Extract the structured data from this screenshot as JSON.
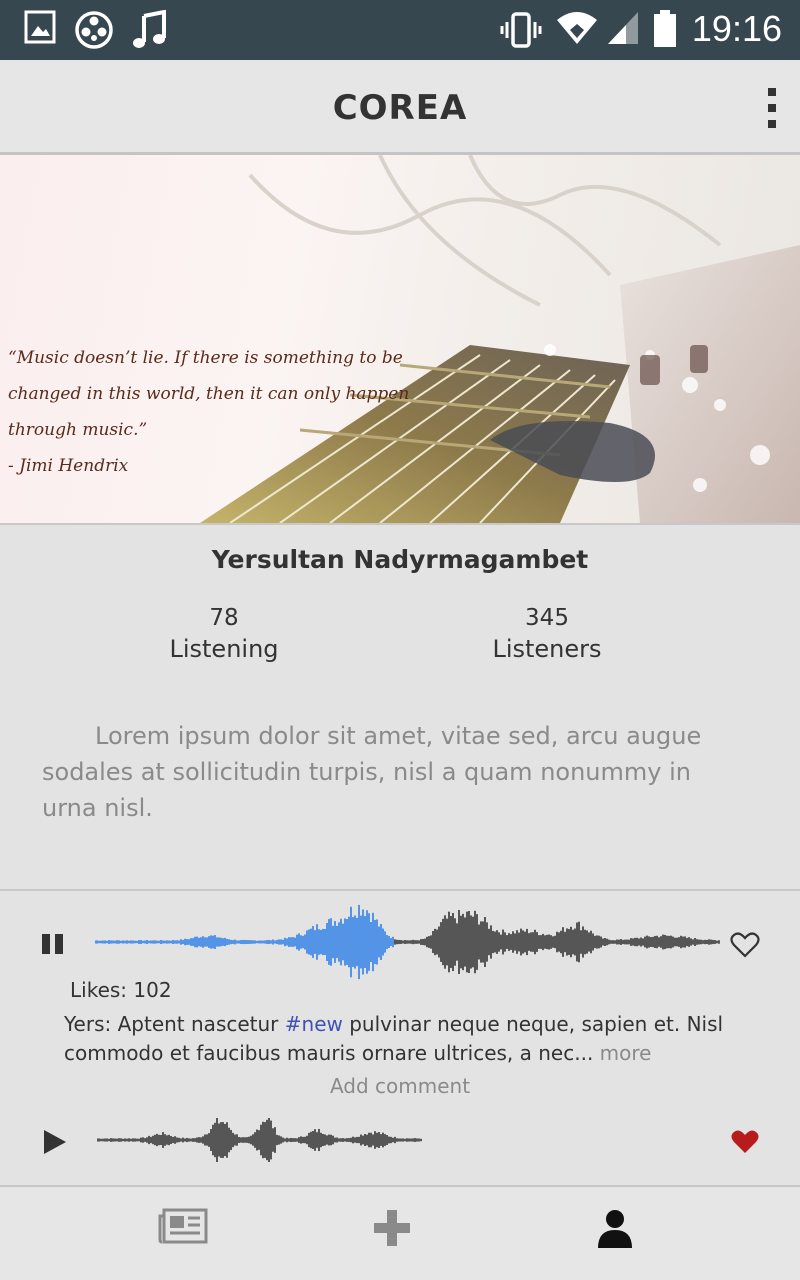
{
  "status_bar": {
    "time": "19:16",
    "icons": [
      "image-icon",
      "film-reel-icon",
      "music-note-icon",
      "vibrate-icon",
      "wifi-icon",
      "signal-icon",
      "battery-icon"
    ]
  },
  "app_bar": {
    "title": "COREA",
    "menu_icon": "overflow-menu-icon"
  },
  "banner": {
    "quote": "“Music doesn’t lie. If there is something to be changed in this world, then it can only happen through music.”",
    "author": "- Jimi Hendrix"
  },
  "profile": {
    "name": "Yersultan Nadyrmagambet",
    "stats": [
      {
        "value": "78",
        "label": "Listening"
      },
      {
        "value": "345",
        "label": "Listeners"
      }
    ],
    "bio": "Lorem ipsum dolor sit amet, vitae sed, arcu augue sodales at sollicitudin turpis, nisl a quam nonummy in urna nisl."
  },
  "feed": {
    "tracks": [
      {
        "state": "playing",
        "control_icon": "pause-icon",
        "liked": false,
        "like_icon": "heart-outline-icon",
        "likes_label": "Likes: 102",
        "author": "Yers:",
        "caption_before": " Aptent nascetur ",
        "hashtag": "#new",
        "caption_after": " pulvinar neque neque, sapien et. Nisl commodo et faucibus mauris ornare ultrices, a nec... ",
        "more": "more",
        "add_comment": "Add comment"
      },
      {
        "state": "paused",
        "control_icon": "play-icon",
        "liked": true,
        "like_icon": "heart-filled-icon"
      }
    ]
  },
  "bottom_nav": {
    "items": [
      {
        "icon": "news-feed-icon"
      },
      {
        "icon": "add-icon"
      },
      {
        "icon": "profile-icon",
        "active": true
      }
    ]
  },
  "colors": {
    "status_bar": "#37474f",
    "waveform_played": "#2f80e8",
    "waveform_unplayed": "#333333",
    "hashtag": "#3f51b5",
    "heart_liked": "#b71c1c"
  }
}
